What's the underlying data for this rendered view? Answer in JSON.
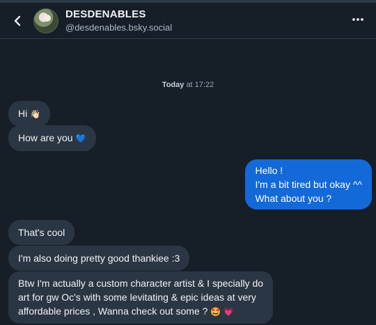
{
  "header": {
    "display_name": "DESDENABLES",
    "handle": "@desdenables.bsky.social",
    "back_icon": "chevron-left-icon",
    "more_icon": "ellipsis-icon"
  },
  "timestamp": {
    "day": "Today",
    "time": "at 17:22"
  },
  "messages": [
    {
      "from": "them",
      "text": "Hi",
      "emoji": "👋🏻"
    },
    {
      "from": "them",
      "text": "How are you",
      "emoji": "💙"
    },
    {
      "from": "me",
      "lines": [
        "Hello !",
        "I'm a bit tired but okay ^^",
        "What about you ?"
      ]
    },
    {
      "from": "them",
      "text": "That's cool"
    },
    {
      "from": "them",
      "text": "I'm also doing pretty good thankiee :3"
    },
    {
      "from": "them",
      "lines": [
        "Btw I'm actually a custom character artist & I specially do",
        "art for gw Oc's with some levitating & epic ideas at very",
        "affordable prices , Wanna check out some ?"
      ],
      "emoji": "🤩 💗"
    }
  ],
  "colors": {
    "background": "#161e27",
    "incoming_bubble": "#2b3644",
    "outgoing_bubble": "#1469d8"
  }
}
